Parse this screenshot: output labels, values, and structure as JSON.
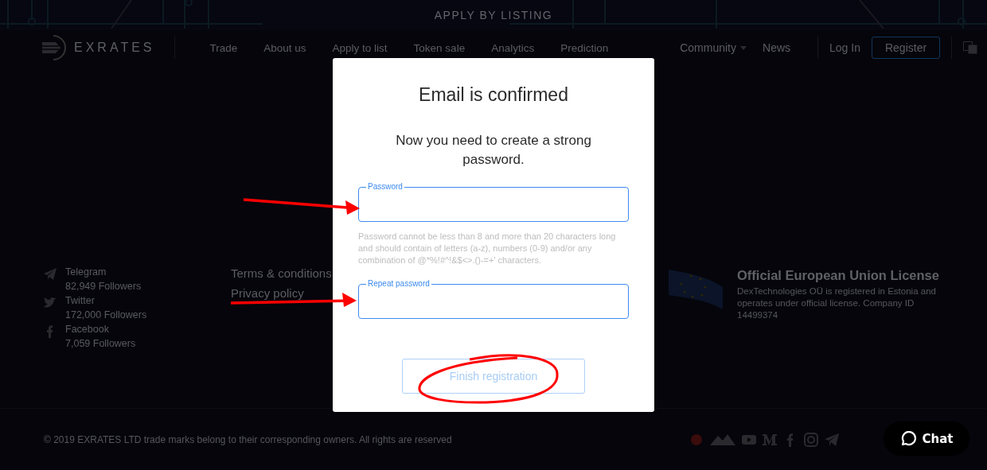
{
  "banner": {
    "title": "APPLY BY LISTING"
  },
  "nav": {
    "logo": "EXRATES",
    "items": [
      "Trade",
      "About us",
      "Apply to list",
      "Token sale",
      "Analytics",
      "Prediction"
    ],
    "community": "Community",
    "news": "News",
    "login": "Log In",
    "register": "Register"
  },
  "footer": {
    "social": [
      {
        "kind": "telegram",
        "name": "Telegram",
        "followers": "82,949 Followers"
      },
      {
        "kind": "twitter",
        "name": "Twitter",
        "followers": "172,000 Followers"
      },
      {
        "kind": "facebook",
        "name": "Facebook",
        "followers": "7,059 Followers"
      }
    ],
    "links": [
      "Terms & conditions",
      "Privacy policy"
    ],
    "license": {
      "title": "Official European Union License",
      "text": "DexTechnologies OÜ is registered in Estonia and operates under official license. Company ID 14499374"
    }
  },
  "bottom": {
    "copyright": "© 2019 EXRATES LTD trade marks belong to their corresponding owners. All rights are reserved"
  },
  "modal": {
    "title": "Email is confirmed",
    "message": "Now you need to create a strong password.",
    "fields": [
      {
        "label": "Password"
      },
      {
        "label": "Repeat password"
      }
    ],
    "hint": "Password cannot be less than 8 and more than 20 characters long and should contain of letters (a-z), numbers (0-9) and/or any combination of @*%!#^!&$<>.()-=+' characters.",
    "button": {
      "label": "Finish registration",
      "disabled": true
    }
  },
  "chat": {
    "label": "Chat"
  },
  "annotations": [
    {
      "kind": "arrow"
    },
    {
      "kind": "arrow"
    },
    {
      "kind": "ellipse"
    }
  ]
}
